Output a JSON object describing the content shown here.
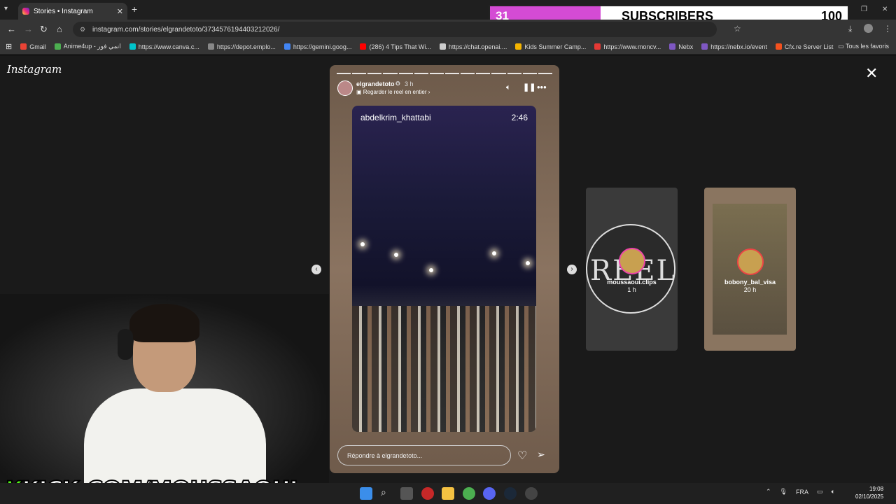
{
  "browser": {
    "tab_title": "Stories • Instagram",
    "url": "instagram.com/stories/elgrandetoto/3734576194403212026/",
    "bookmarks": [
      {
        "label": "Gmail",
        "color": "#ea4335"
      },
      {
        "label": "Anime4up - انمي فور",
        "color": "#4caf50"
      },
      {
        "label": "https://www.canva.c...",
        "color": "#00c4cc"
      },
      {
        "label": "https://depot.emplo...",
        "color": "#888888"
      },
      {
        "label": "https://gemini.goog...",
        "color": "#4285f4"
      },
      {
        "label": "(286) 4 Tips That Wi...",
        "color": "#ff0000"
      },
      {
        "label": "https://chat.openai....",
        "color": "#cccccc"
      },
      {
        "label": "Kids Summer Camp...",
        "color": "#f5b400"
      },
      {
        "label": "https://www.moncv...",
        "color": "#e53935"
      },
      {
        "label": "Nebx",
        "color": "#7e57c2"
      },
      {
        "label": "https://nebx.io/event",
        "color": "#7e57c2"
      },
      {
        "label": "Cfx.re Server List",
        "color": "#f4511e"
      }
    ],
    "all_bookmarks": "Tous les favoris"
  },
  "subscribers_overlay": {
    "current": "31",
    "label": "SUBSCRIBERS",
    "goal": "100",
    "progress_fraction": 0.31,
    "fill_color": "#d44bd4"
  },
  "instagram": {
    "logo": "Instagram",
    "story": {
      "username": "elgrandetoto",
      "time_ago": "3 h",
      "reel_link": "Regarder le reel en entier",
      "segments": 14,
      "reel_author": "abdelkrim_khattabi",
      "reel_duration": "2:46",
      "reply_placeholder": "Répondre à elgrandetoto..."
    },
    "upcoming": [
      {
        "username": "moussaoui.clips",
        "time_ago": "1 h",
        "preview_text": "REEL"
      },
      {
        "username": "bobony_bal_visa",
        "time_ago": "20 h"
      }
    ]
  },
  "stream": {
    "kick_k": "K",
    "kick_rest": "KICK.COM/MOUSSAOUI"
  },
  "taskbar": {
    "language": "FRA",
    "time": "19:08",
    "date": "02/10/2025"
  }
}
